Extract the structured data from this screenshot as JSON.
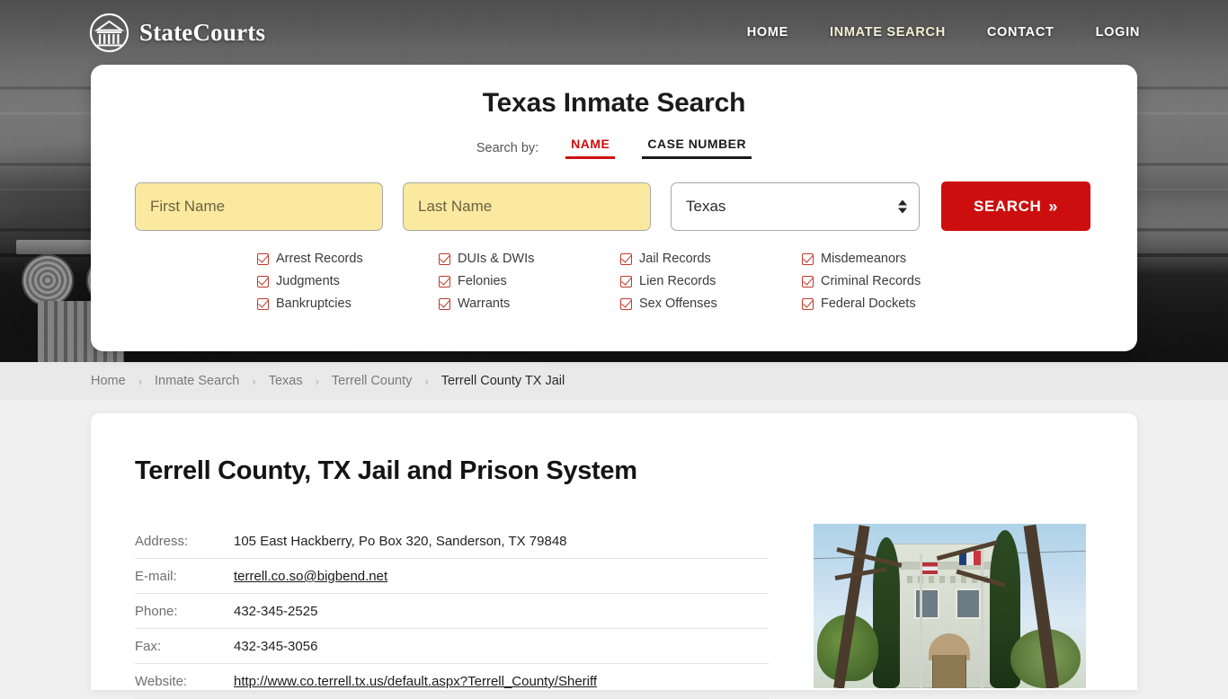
{
  "brand": {
    "name": "StateCourts",
    "logo_icon": "courthouse-circle-icon"
  },
  "nav": {
    "items": [
      {
        "label": "HOME",
        "active": false
      },
      {
        "label": "INMATE SEARCH",
        "active": true
      },
      {
        "label": "CONTACT",
        "active": false
      },
      {
        "label": "LOGIN",
        "active": false
      }
    ]
  },
  "search": {
    "title": "Texas Inmate Search",
    "search_by_label": "Search by:",
    "tabs": [
      {
        "label": "NAME",
        "active": true
      },
      {
        "label": "CASE NUMBER",
        "active": false
      }
    ],
    "first_name": {
      "value": "",
      "placeholder": "First Name"
    },
    "last_name": {
      "value": "",
      "placeholder": "Last Name"
    },
    "state": {
      "value": "Texas"
    },
    "button_label": "SEARCH",
    "button_chevron": "»",
    "accent_red": "#cc0e0e",
    "field_highlight": "#fbe9a0",
    "checkboxes": [
      "Arrest Records",
      "DUIs & DWIs",
      "Jail Records",
      "Misdemeanors",
      "Judgments",
      "Felonies",
      "Lien Records",
      "Criminal Records",
      "Bankruptcies",
      "Warrants",
      "Sex Offenses",
      "Federal Dockets"
    ]
  },
  "breadcrumb": {
    "separator": "›",
    "items": [
      {
        "label": "Home",
        "current": false
      },
      {
        "label": "Inmate Search",
        "current": false
      },
      {
        "label": "Texas",
        "current": false
      },
      {
        "label": "Terrell County",
        "current": false
      },
      {
        "label": "Terrell County TX Jail",
        "current": true
      }
    ]
  },
  "main": {
    "page_title": "Terrell County, TX Jail and Prison System",
    "details": [
      {
        "key": "Address:",
        "value": "105 East Hackberry, Po Box 320, Sanderson, TX 79848",
        "link": false
      },
      {
        "key": "E-mail:",
        "value": "terrell.co.so@bigbend.net",
        "link": true
      },
      {
        "key": "Phone:",
        "value": "432-345-2525",
        "link": false
      },
      {
        "key": "Fax:",
        "value": "432-345-3056",
        "link": false
      },
      {
        "key": "Website:",
        "value": "http://www.co.terrell.tx.us/default.aspx?Terrell_County/Sheriff",
        "link": true
      }
    ],
    "photo_alt": "terrell-county-courthouse-photo"
  }
}
